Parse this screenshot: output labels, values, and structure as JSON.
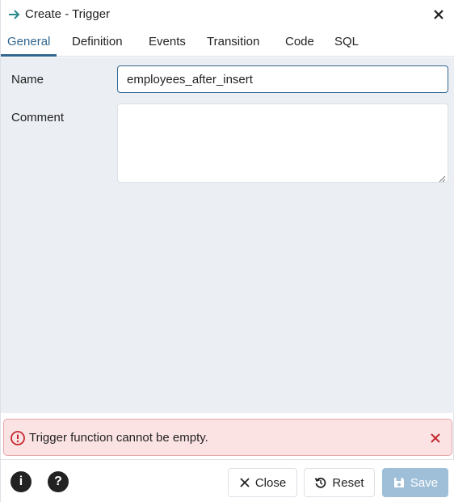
{
  "dialog": {
    "title": "Create - Trigger",
    "title_icon": "trigger-arrow-icon",
    "close_icon": "close-icon"
  },
  "tabs": [
    {
      "label": "General",
      "active": true
    },
    {
      "label": "Definition",
      "active": false
    },
    {
      "label": "Events",
      "active": false
    },
    {
      "label": "Transition",
      "active": false
    },
    {
      "label": "Code",
      "active": false
    },
    {
      "label": "SQL",
      "active": false
    }
  ],
  "form": {
    "name_label": "Name",
    "name_value": "employees_after_insert",
    "comment_label": "Comment",
    "comment_value": ""
  },
  "error": {
    "message": "Trigger function cannot be empty.",
    "icon": "error-circle-icon",
    "close_icon": "close-icon"
  },
  "footer": {
    "info_label": "i",
    "help_label": "?",
    "close_label": "Close",
    "reset_label": "Reset",
    "save_label": "Save"
  },
  "colors": {
    "accent": "#326690",
    "content_bg": "#ebeef3",
    "error_bg": "#fbe3e4",
    "error_border": "#e8a6aa",
    "error_icon": "#c4282e",
    "save_disabled": "#9fbfd8"
  }
}
